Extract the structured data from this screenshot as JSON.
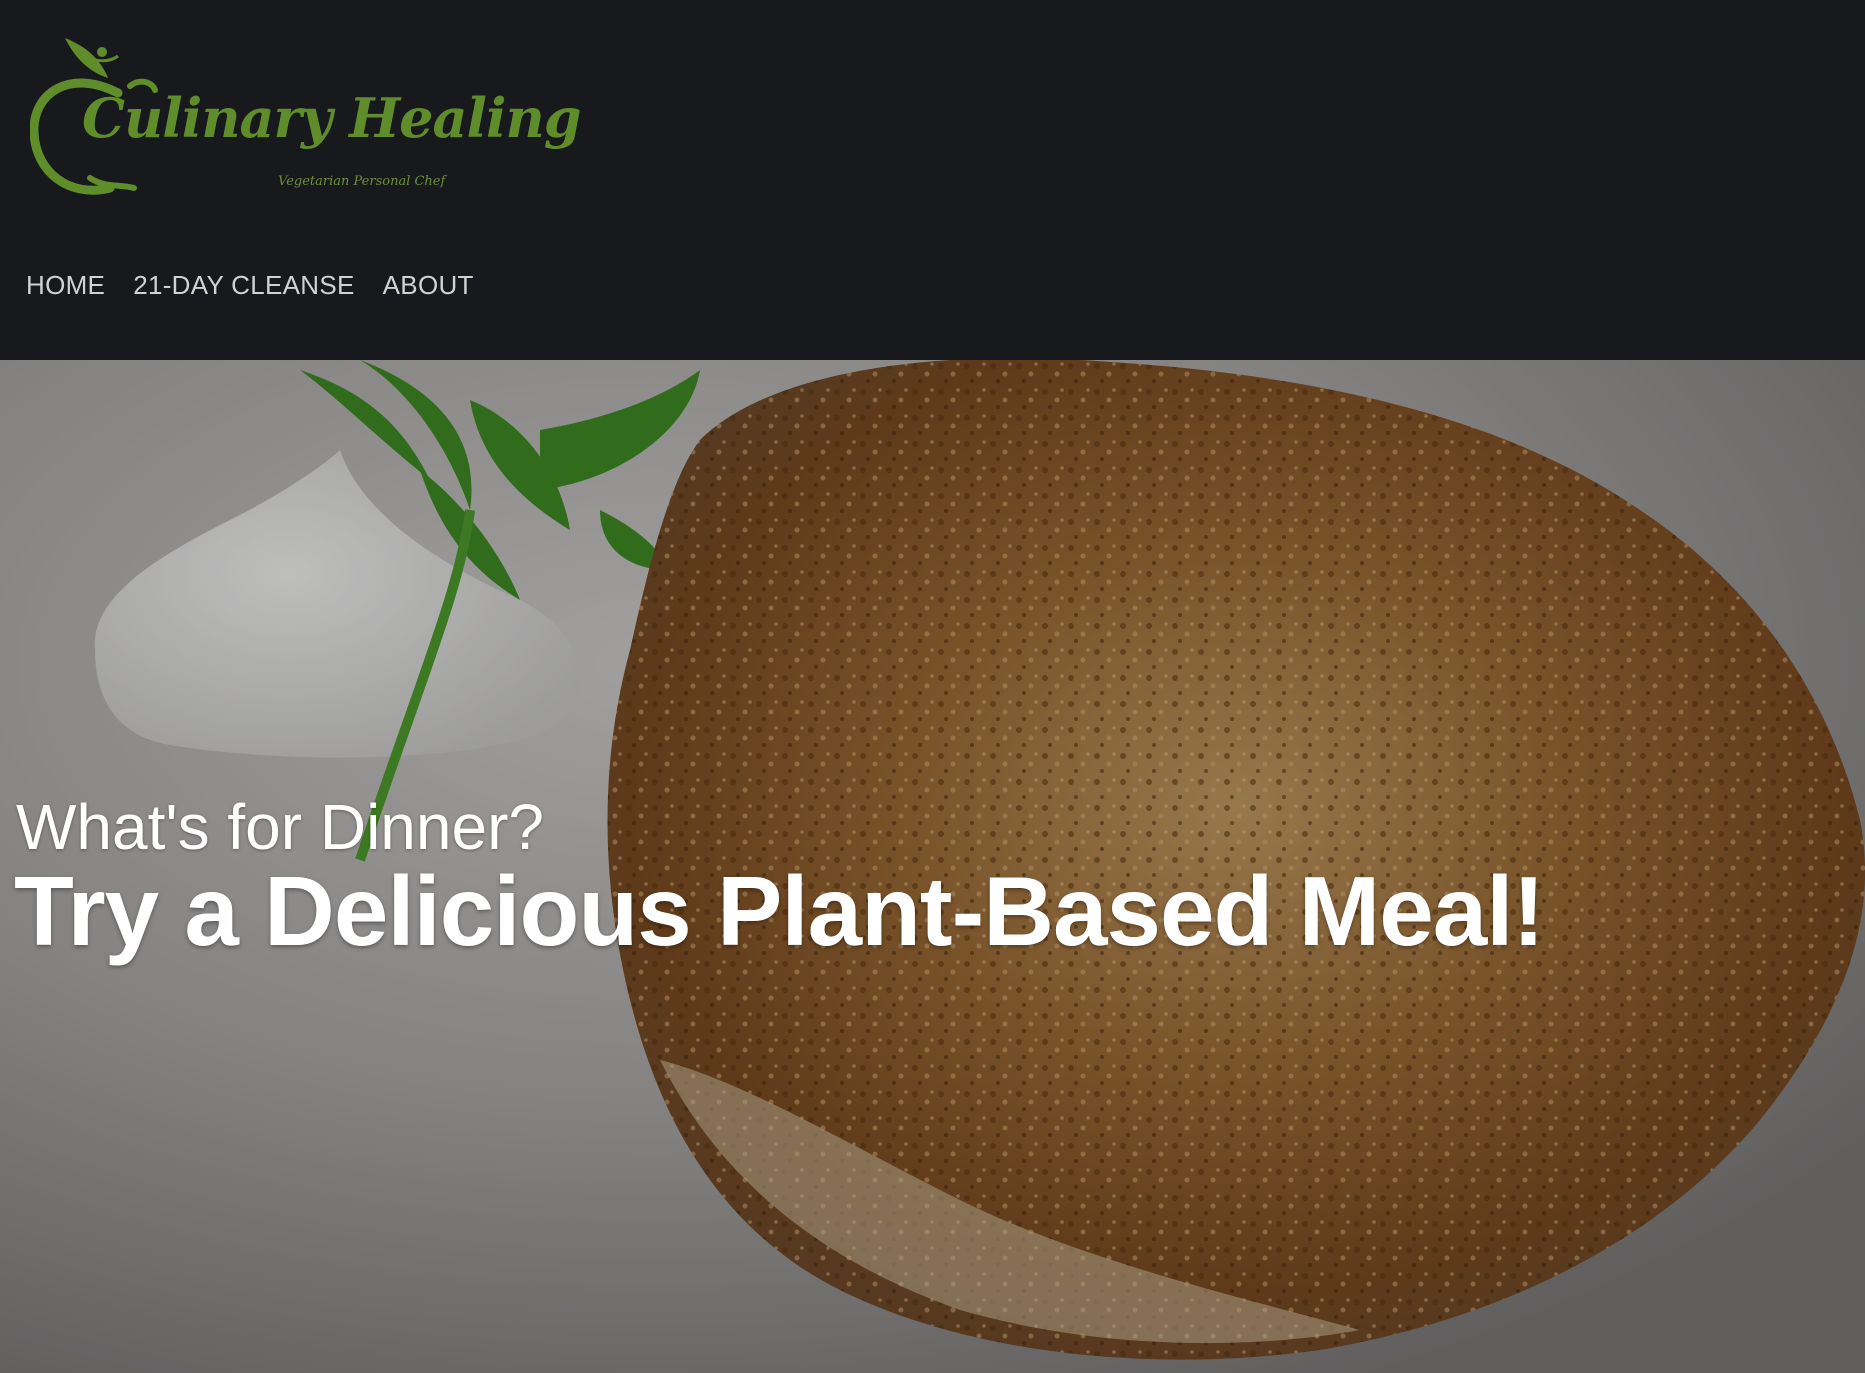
{
  "brand": {
    "name": "Culinary Healing",
    "tagline": "Vegetarian Personal Chef",
    "logo_icon": "apple-leaf-icon",
    "color": "#5f8d2a"
  },
  "nav": {
    "items": [
      {
        "label": "HOME"
      },
      {
        "label": "21-DAY CLEANSE"
      },
      {
        "label": "ABOUT"
      }
    ]
  },
  "hero": {
    "subtitle": "What's for Dinner?",
    "title": "Try a Delicious Plant-Based Meal!",
    "image": "fried-plant-based-cake-with-sour-cream-and-parsley"
  },
  "colors": {
    "header_bg": "#18191c",
    "nav_text": "#d2d2d2",
    "hero_text": "#ffffff"
  }
}
